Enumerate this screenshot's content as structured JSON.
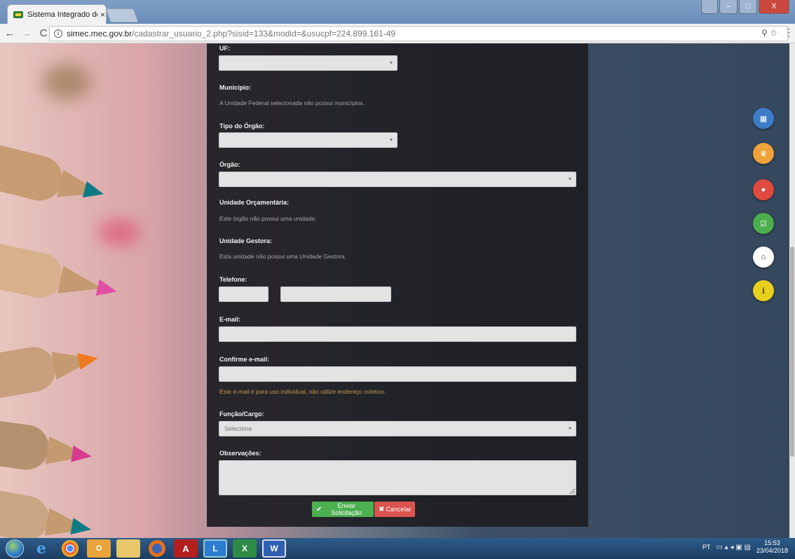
{
  "browser": {
    "tab_title": "Sistema Integrado de Mo",
    "tab_close": "×",
    "url_host": "simec.mec.gov.br",
    "url_path": "/cadastrar_usuario_2.php?sisid=133&modid=&usucpf=224.899.161-49",
    "window_controls": {
      "minimize": "–",
      "maximize": "□",
      "close": "X"
    }
  },
  "form": {
    "uf_label": "UF:",
    "municipio_label": "Município:",
    "municipio_note": "A Unidade Federal selecionada não possui municípios.",
    "tipo_orgao_label": "Tipo do Órgão:",
    "orgao_label": "Órgão:",
    "unidade_orcamentaria_label": "Unidade Orçamentária:",
    "unidade_orcamentaria_note": "Este órgão não possui uma unidade.",
    "unidade_gestora_label": "Unidade Gestora:",
    "unidade_gestora_note": "Esta unidade não possui uma Unidade Gestora.",
    "telefone_label": "Telefone:",
    "email_label": "E-mail:",
    "confirme_email_label": "Confirme e-mail:",
    "email_warning": "Este e-mail é para uso individual, não utilize endereço coletivo.",
    "funcao_label": "Função/Cargo:",
    "funcao_value": "Selecione",
    "observacoes_label": "Observações:",
    "submit_label": "Enviar Solicitação",
    "cancel_label": "Cancelar"
  },
  "floating_buttons": [
    "apps-icon",
    "trophy-icon",
    "chat-icon",
    "check-icon",
    "bank-icon",
    "info-icon"
  ],
  "taskbar": {
    "apps": [
      "start",
      "internet-explorer",
      "chrome",
      "outlook",
      "file-explorer",
      "firefox",
      "acrobat",
      "lync",
      "excel",
      "word"
    ],
    "language": "PT",
    "time": "15:53",
    "date": "23/04/2018"
  },
  "colors": {
    "panel_bg": "#1e1e22",
    "submit": "#4caf50",
    "cancel": "#d9534f",
    "warning_text": "#c2984a"
  }
}
